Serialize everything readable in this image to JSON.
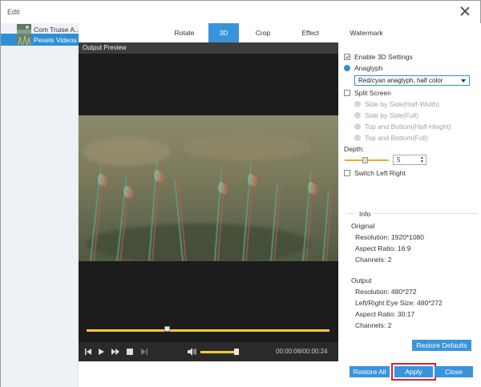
{
  "window": {
    "title": "Edit"
  },
  "files": [
    {
      "name": "Com Truise A..."
    },
    {
      "name": "Pexels Videos ..."
    }
  ],
  "tabs": [
    {
      "label": "Rotate"
    },
    {
      "label": "3D"
    },
    {
      "label": "Crop"
    },
    {
      "label": "Effect"
    },
    {
      "label": "Watermark"
    }
  ],
  "active_tab": "3D",
  "preview": {
    "heading": "Output Preview",
    "seek_progress": 0.33,
    "volume": 0.9,
    "time": "00:00:08/00:00:24"
  },
  "settings": {
    "enable_3d": {
      "label": "Enable 3D Settings",
      "checked": true
    },
    "anaglyph": {
      "label": "Anaglyph",
      "selected": true
    },
    "anaglyph_mode": "Red/cyan anaglyph, half color",
    "split_screen": {
      "label": "Split Screen",
      "selected": false
    },
    "split_options": [
      "Side by Side(Half-Width)",
      "Side by Side(Full)",
      "Top and Bottom(Half-Height)",
      "Top and Bottom(Full)"
    ],
    "depth_label": "Depth:",
    "depth_value": "5",
    "switch_lr": {
      "label": "Switch Left Right",
      "checked": false
    }
  },
  "info": {
    "legend": "Info",
    "original_heading": "Original",
    "original": {
      "resolution": "Resolution: 1920*1080",
      "aspect": "Aspect Ratio: 16:9",
      "channels": "Channels: 2"
    },
    "output_heading": "Output",
    "output": {
      "resolution": "Resolution: 480*272",
      "eye_size": "Left/Right Eye Size: 480*272",
      "aspect": "Aspect Ratio: 30:17",
      "channels": "Channels: 2"
    }
  },
  "buttons": {
    "restore_defaults": "Restore Defaults",
    "restore_all": "Restore All",
    "apply": "Apply",
    "close": "Close"
  },
  "colors": {
    "accent": "#3a94dc",
    "highlight": "#d9232e",
    "slider": "#ffc83a"
  }
}
